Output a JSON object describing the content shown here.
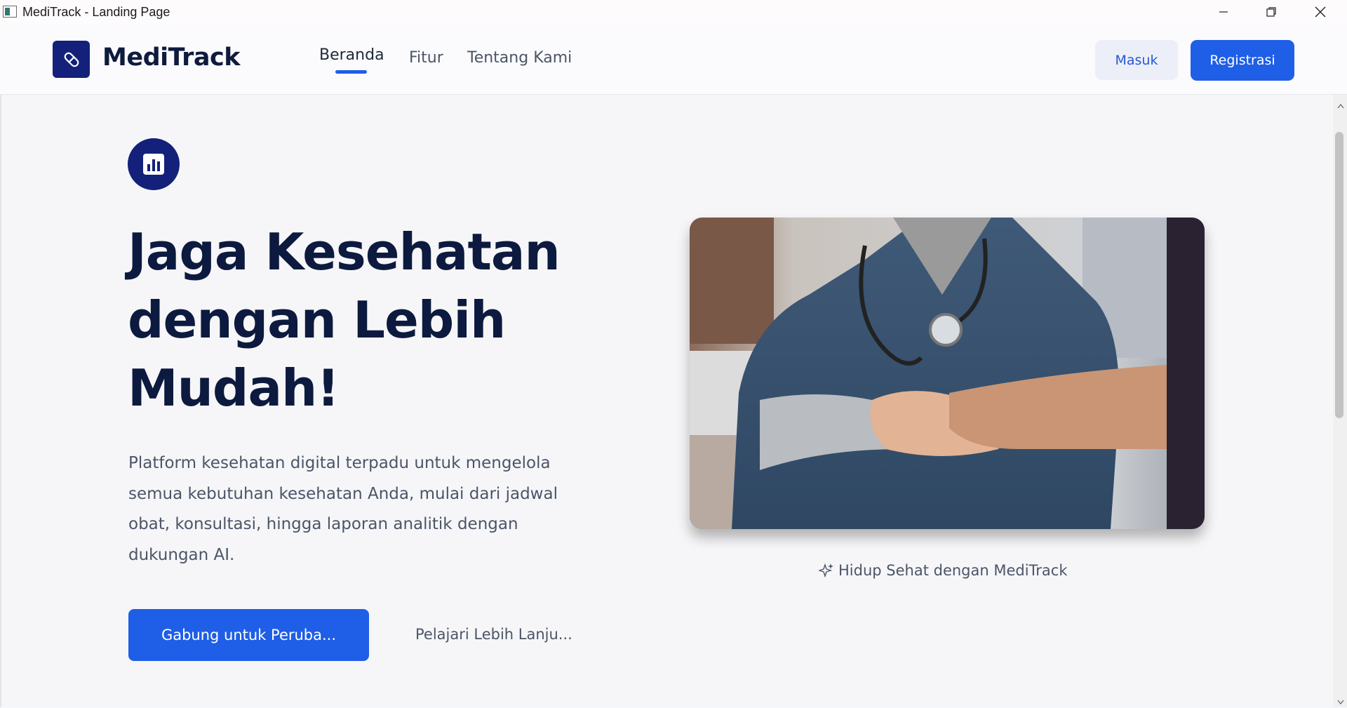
{
  "window": {
    "title": "MediTrack - Landing Page",
    "controls": [
      "minimize-icon",
      "restore-icon",
      "close-icon"
    ]
  },
  "navbar": {
    "brand": "MediTrack",
    "logo_icon": "pill-icon",
    "items": [
      {
        "label": "Beranda",
        "active": true
      },
      {
        "label": "Fitur",
        "active": false
      },
      {
        "label": "Tentang Kami",
        "active": false
      }
    ],
    "login_label": "Masuk",
    "register_label": "Registrasi"
  },
  "hero": {
    "badge_icon": "bar-chart-icon",
    "headline": "Jaga Kesehatan dengan Lebih Mudah!",
    "description": "Platform kesehatan digital terpadu untuk mengelola semua kebutuhan kesehatan Anda, mulai dari jadwal obat, konsultasi, hingga laporan analitik dengan dukungan AI.",
    "primary_cta": "Gabung untuk Peruba...",
    "secondary_cta": "Pelajari Lebih Lanju...",
    "image_caption": "Hidup Sehat dengan MediTrack",
    "caption_icon": "sparkle-icon"
  },
  "colors": {
    "accent": "#1f5ee6",
    "brand_dark": "#13217a",
    "headline": "#0d1a3f",
    "body_text": "#4b5568"
  }
}
